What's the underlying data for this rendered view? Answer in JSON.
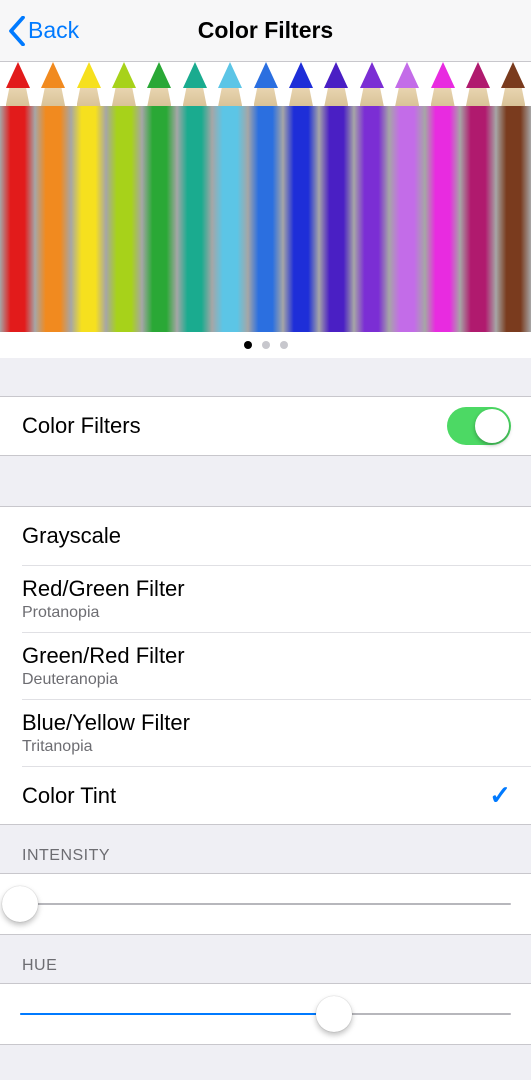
{
  "header": {
    "back_label": "Back",
    "title": "Color Filters"
  },
  "preview": {
    "pencil_colors": [
      "#e21b1b",
      "#f18a1f",
      "#f6e01e",
      "#a7d21a",
      "#2aa836",
      "#1aab8f",
      "#5cc5e6",
      "#2b6fe0",
      "#1e2ed8",
      "#4a1fc4",
      "#7b2ed4",
      "#c36ce8",
      "#e82be0",
      "#b01a6e",
      "#7a3b1e"
    ],
    "page_count": 3,
    "page_index": 0
  },
  "toggle": {
    "label": "Color Filters",
    "on": true
  },
  "filter_options": [
    {
      "title": "Grayscale",
      "subtitle": null,
      "selected": false
    },
    {
      "title": "Red/Green Filter",
      "subtitle": "Protanopia",
      "selected": false
    },
    {
      "title": "Green/Red Filter",
      "subtitle": "Deuteranopia",
      "selected": false
    },
    {
      "title": "Blue/Yellow Filter",
      "subtitle": "Tritanopia",
      "selected": false
    },
    {
      "title": "Color Tint",
      "subtitle": null,
      "selected": true
    }
  ],
  "sliders": {
    "intensity": {
      "label": "INTENSITY",
      "value": 0
    },
    "hue": {
      "label": "HUE",
      "value": 64
    }
  }
}
